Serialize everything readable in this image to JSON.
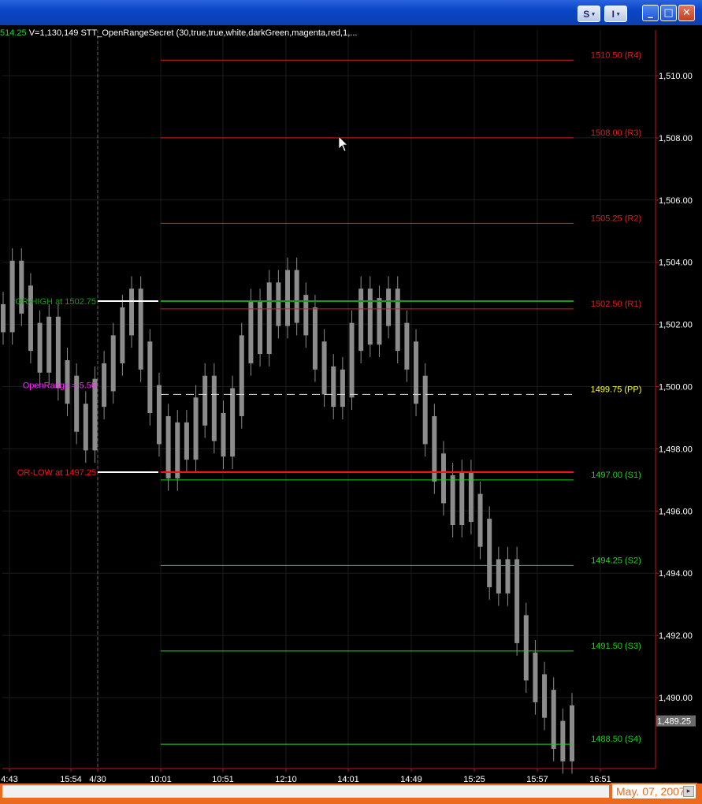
{
  "window": {
    "toolbar_s": "S",
    "toolbar_i": "I",
    "minimize": "_",
    "maximize": "□",
    "close": "✕"
  },
  "header": {
    "last_price": "514.25",
    "info": "V=1,130,149  STT_OpenRangeSecret (30,true,true,white,darkGreen,magenta,red,1,..."
  },
  "colors": {
    "background": "#000000",
    "resistance": "#e01b1b",
    "support": "#22d022",
    "pivot": "#ffff33",
    "range": "#ff22ff",
    "price_bars": "#8c8c8c",
    "window_frame": "#ec6a1d"
  },
  "chart_data": {
    "type": "bar",
    "ylim": [
      1487.5,
      1511.5
    ],
    "y_ticks": [
      "1,510.00",
      "1,508.00",
      "1,506.00",
      "1,504.00",
      "1,502.00",
      "1,500.00",
      "1,498.00",
      "1,496.00",
      "1,494.00",
      "1,492.00",
      "1,490.00"
    ],
    "x_ticks": [
      "4:43",
      "15:54",
      "4/30",
      "10:01",
      "10:51",
      "12:10",
      "14:01",
      "14:49",
      "15:25",
      "15:57",
      "16:51"
    ],
    "current_price_label": "1,489.25",
    "levels": [
      {
        "label": "1510.50  (R4)",
        "value": 1510.5,
        "color": "#e01b1b"
      },
      {
        "label": "1508.00  (R3)",
        "value": 1508.0,
        "color": "#e01b1b"
      },
      {
        "label": "1505.25  (R2)",
        "value": 1505.25,
        "color": "#e01b1b"
      },
      {
        "label": "1502.50  (R1)",
        "value": 1502.5,
        "color": "#e01b1b"
      },
      {
        "label": "1499.75  (PP)",
        "value": 1499.75,
        "color": "#ffff33",
        "dashed": true
      },
      {
        "label": "1497.00  (S1)",
        "value": 1497.0,
        "color": "#22d022"
      },
      {
        "label": "1494.25  (S2)",
        "value": 1494.25,
        "color": "#22d022"
      },
      {
        "label": "1491.50  (S3)",
        "value": 1491.5,
        "color": "#22d022"
      },
      {
        "label": "1488.50  (S4)",
        "value": 1488.5,
        "color": "#22d022"
      }
    ],
    "open_range": {
      "high_label": "OR-HIGH  at  1502.75",
      "high": 1502.75,
      "low_label": "OR-LOW  at  1497.25",
      "low": 1497.25,
      "size_label": "OpenRange =  5.50"
    },
    "price_series": [
      1502.2,
      1503.6,
      1502.8,
      1501.6,
      1500.9,
      1501.8,
      1500.4,
      1499.9,
      1499.0,
      1498.4,
      1499.8,
      1500.3,
      1501.2,
      1502.1,
      1502.7,
      1501.0,
      1499.6,
      1498.6,
      1497.5,
      1498.4,
      1498.1,
      1499.2,
      1499.9,
      1498.7,
      1498.2,
      1499.5,
      1501.2,
      1502.3,
      1501.5,
      1502.9,
      1502.4,
      1503.3,
      1502.5,
      1502.1,
      1501.0,
      1500.2,
      1499.8,
      1500.1,
      1501.6,
      1502.7,
      1501.8,
      1502.4,
      1502.7,
      1501.6,
      1501.0,
      1499.9,
      1498.6,
      1497.4,
      1496.7,
      1496.0,
      1496.8,
      1496.1,
      1495.3,
      1494.0,
      1493.8,
      1494.0,
      1492.2,
      1491.0,
      1490.3,
      1489.8,
      1488.8,
      1488.4,
      1489.3
    ]
  },
  "footer": {
    "date": "May. 07, 2007",
    "spin": "▸"
  }
}
